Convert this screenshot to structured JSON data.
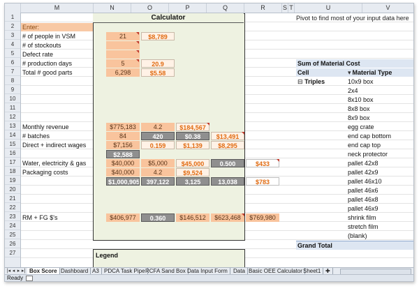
{
  "columns": [
    "M",
    "N",
    "O",
    "P",
    "Q",
    "R",
    "S",
    "T",
    "U",
    "V"
  ],
  "rows": [
    "1",
    "2",
    "3",
    "4",
    "5",
    "6",
    "7",
    "8",
    "9",
    "10",
    "11",
    "12",
    "13",
    "14",
    "15",
    "16",
    "17",
    "18",
    "19",
    "20",
    "21",
    "22",
    "23",
    "24",
    "25",
    "26",
    "27"
  ],
  "calculator_title": "Calculator",
  "labels": {
    "enter": "Enter:",
    "people": "# of people in VSM",
    "stockouts": "# of stockouts",
    "defect": "Defect rate",
    "prod_days": "# production days",
    "good_parts": "Total # good parts",
    "revenue": "Monthly revenue",
    "batches": "# batches",
    "wages": "Direct + indirect wages",
    "water": "Water, electricity & gas",
    "packaging": "Packaging costs",
    "rmfg": "RM + FG $'s",
    "legend": "Legend"
  },
  "values": {
    "r3n": "21",
    "r3o": "$8,789",
    "r6n": "5",
    "r6o": "20.9",
    "r7n": "6,298",
    "r7o": "$5.58",
    "r13n": "$775,183",
    "r13o": "4.2",
    "r13p": "$184,567",
    "r14n": "84",
    "r14o": "420",
    "r14p": "$0.38",
    "r14q": "$13,491",
    "r15n": "$7,156",
    "r15o": "0.159",
    "r15p": "$1,139",
    "r15q": "$8,295",
    "r16n": "$2,588",
    "r17n": "$40,000",
    "r17o": "$5,000",
    "r17p": "$45,000",
    "r17q": "0.500",
    "r17r": "$433",
    "r18n": "$40,000",
    "r18o": "4.2",
    "r18p": "$9,524",
    "r19n": "$1,000,905",
    "r19o": "397,122",
    "r19p": "3,125",
    "r19q": "13,038",
    "r19r": "$783",
    "r23n": "$406,977",
    "r23o": "0.360",
    "r23p": "$146,512",
    "r23q": "$623,468",
    "r23r": "$769,980"
  },
  "pivot": {
    "note": "Pivot to find most of your input data here",
    "sum_label": "Sum of Material Cost",
    "cell_header": "Cell",
    "material_header": "Material Type",
    "group": "Triples",
    "items": [
      "10x9 box",
      "2x4",
      "8x10 box",
      "8x8 box",
      "8x9 box",
      "egg crate",
      "end cap bottom",
      "end cap top",
      "neck protector",
      "pallet 42x8",
      "pallet 42x9",
      "pallet 46x10",
      "pallet 46x6",
      "pallet 46x8",
      "pallet 46x9",
      "shrink film",
      "stretch film",
      "(blank)"
    ],
    "grand_total": "Grand Total"
  },
  "sheet_tabs": [
    "Box Score",
    "Dashboard",
    "A3",
    "PDCA Task Pipe",
    "RCFA Sand Box",
    "Data Input Form",
    "Data",
    "Basic OEE Calculator",
    "Sheet1"
  ],
  "status": "Ready"
}
